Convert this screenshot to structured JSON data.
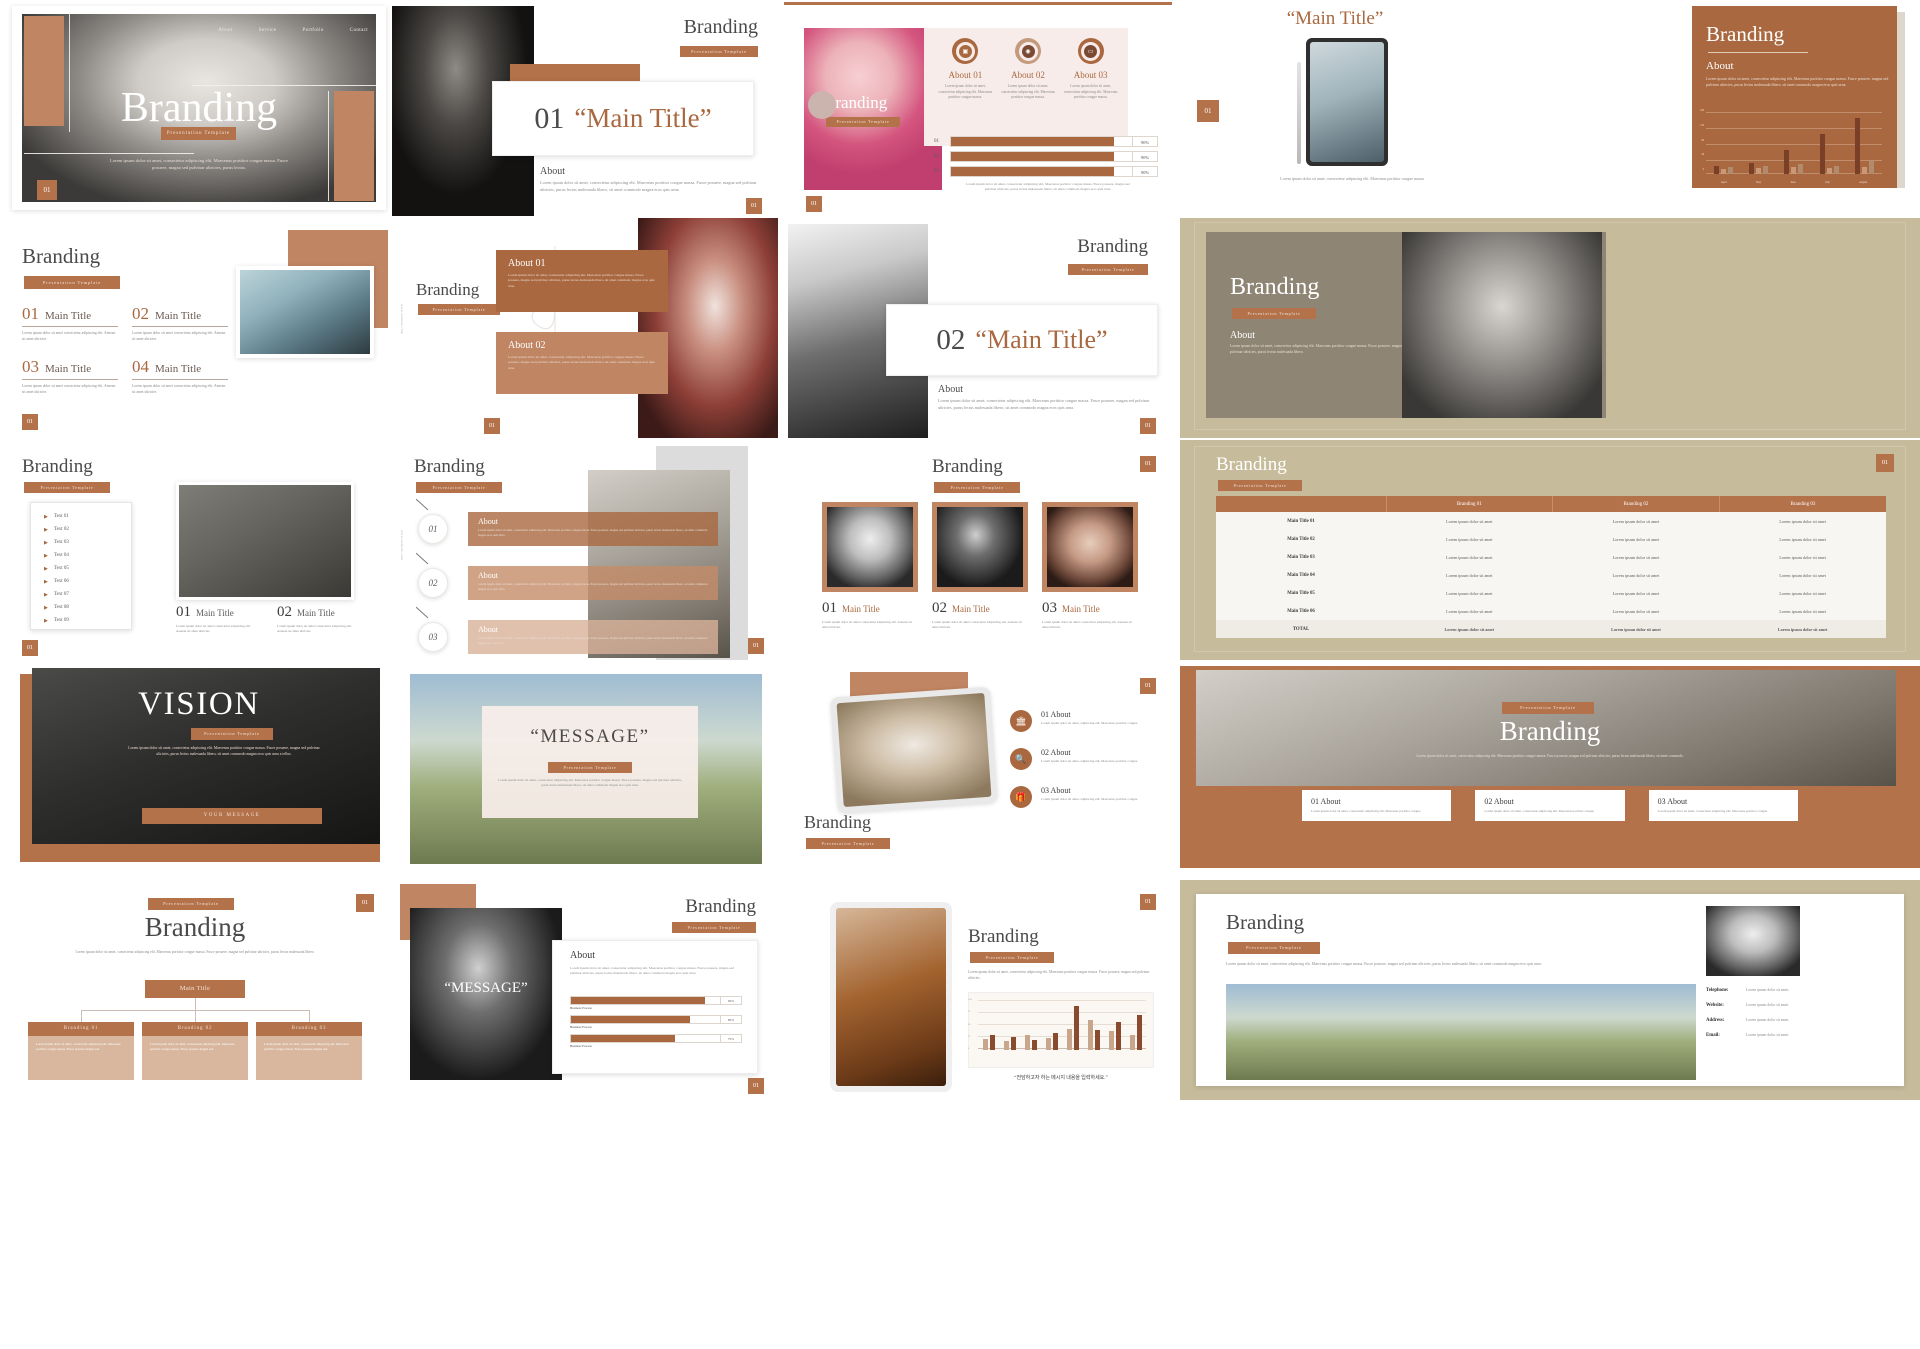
{
  "theme": {
    "accent": "#b3724a",
    "accent_dark": "#a9683f",
    "accent_light": "#c89a7c",
    "beige": "#c6bb9a",
    "taupe": "#8e8574",
    "cream": "#f7efe9",
    "text_dark": "#4a4a4a",
    "text_muted": "#8b8b8b"
  },
  "common": {
    "brand": "Branding",
    "template_badge": "Presentation Template",
    "about": "About",
    "page_num": "01",
    "lorem_short": "Lorem ipsum dolor sit amet, consectetur adipiscing elit. Maecenas porttitor congue massa.",
    "lorem_mid": "Lorem ipsum dolor sit amet, consectetur adipiscing elit. Maecenas porttitor congue massa. Fusce posuere, magna sed pulvinar ultricies, purus lectus malesuada libero, sit amet commodo magna eros quis urna.",
    "lorem_cell": "Lorem ipsum dolor sit amet",
    "lorem_tiny": "Lorem ipsum dolor sit amet consectetur adipiscing elit. Aenean sit amet ultricies"
  },
  "slide01": {
    "title": "Branding",
    "badge": "Presentation Template",
    "nav": [
      "About",
      "Service",
      "Portfolio",
      "Contact"
    ],
    "body": "Lorem ipsum dolor sit amet, consectetur adipiscing elit. Maecenas porttitor congue massa. Fusce posuere, magna sed pulvinar ultricies, purus lectus.",
    "num": "01"
  },
  "slide02": {
    "brand": "Branding",
    "badge": "Presentation Template",
    "number": "01",
    "main_title": "“Main Title”",
    "about": "About",
    "body": "Lorem ipsum dolor sit amet, consectetur adipiscing elit. Maecenas porttitor congue massa. Fusce posuere, magna sed pulvinar ultricies, purus lectus malesuada libero, sit amet commodo magna eros quis urna.",
    "num": "01"
  },
  "slide03": {
    "brand": "Branding",
    "badge": "Presentation Template",
    "cards": [
      {
        "icon": "image-icon",
        "title": "About 01",
        "body": "Lorem ipsum dolor sit amet, consectetur adipiscing elit. Maecenas porttitor congue massa."
      },
      {
        "icon": "camera-icon",
        "title": "About 02",
        "body": "Lorem ipsum dolor sit amet, consectetur adipiscing elit. Maecenas porttitor congue massa."
      },
      {
        "icon": "laptop-icon",
        "title": "About 03",
        "body": "Lorem ipsum dolor sit amet, consectetur adipiscing elit. Maecenas porttitor congue massa."
      }
    ],
    "bars": [
      {
        "label": "01",
        "pct": "90%",
        "value": 90
      },
      {
        "label": "02",
        "pct": "90%",
        "value": 90
      },
      {
        "label": "03",
        "pct": "90%",
        "value": 90
      }
    ],
    "footer": "Lorem ipsum dolor sit amet, consectetur adipiscing elit. Maecenas porttitor congue massa. Fusce posuere, magna sed pulvinar ultricies, purus lectus malesuada libero, sit amet commodo magna eros quis urna.",
    "num": "01"
  },
  "slide04": {
    "main_title": "“Main Title”",
    "number": "01",
    "caption": "Lorem ipsum dolor sit amet, consectetur adipiscing elit. Maecenas porttitor congue massa"
  },
  "slide05": {
    "brand": "Branding",
    "about": "About",
    "body": "Lorem ipsum dolor sit amet, consectetur adipiscing elit. Maecenas porttitor congue massa. Fusce posuere, magna sed pulvinar ultricies, purus lectus malesuada libero, sit amet commodo magna eros quis urna.",
    "chart_data": {
      "type": "bar",
      "title": "",
      "categories": [
        "April",
        "May",
        "June",
        "July",
        "August"
      ],
      "series": [
        {
          "name": "Series 1",
          "values": [
            18,
            25,
            55,
            20,
            14
          ]
        },
        {
          "name": "Series 2",
          "values": [
            10,
            12,
            14,
            92,
            130
          ]
        },
        {
          "name": "Series 3",
          "values": [
            14,
            16,
            22,
            18,
            28
          ]
        }
      ],
      "ylim": [
        0,
        160
      ],
      "yticks": [
        "0",
        "40",
        "80",
        "120",
        "160"
      ],
      "grid": true,
      "legend": "none"
    }
  },
  "slide06": {
    "brand": "Branding",
    "badge": "Presentation Template",
    "items": [
      {
        "num": "01",
        "title": "Main Title",
        "body": "Lorem ipsum dolor sit amet consectetur adipiscing elit. Aenean sit amet ultricies"
      },
      {
        "num": "02",
        "title": "Main Title",
        "body": "Lorem ipsum dolor sit amet consectetur adipiscing elit. Aenean sit amet ultricies"
      },
      {
        "num": "03",
        "title": "Main Title",
        "body": "Lorem ipsum dolor sit amet consectetur adipiscing elit. Aenean sit amet ultricies"
      },
      {
        "num": "04",
        "title": "Main Title",
        "body": "Lorem ipsum dolor sit amet consectetur adipiscing elit. Aenean sit amet ultricies"
      }
    ],
    "num": "01"
  },
  "slide07": {
    "brand": "Branding",
    "badge": "Presentation Template",
    "vertical_label": "www.website.com",
    "blocks": [
      {
        "title": "About 01",
        "body": "Lorem ipsum dolor sit amet, consectetur adipiscing elit. Maecenas porttitor congue massa. Fusce posuere, magna sed pulvinar ultricies, purus lectus malesuada libero, sit amet commodo magna eros quis urna."
      },
      {
        "title": "About 02",
        "body": "Lorem ipsum dolor sit amet, consectetur adipiscing elit. Maecenas porttitor congue massa. Fusce posuere, magna sed pulvinar ultricies, purus lectus malesuada libero, sit amet commodo magna eros quis urna."
      }
    ],
    "num": "01"
  },
  "slide08": {
    "brand": "Branding",
    "badge": "Presentation Template",
    "number": "02",
    "main_title": "“Main Title”",
    "about": "About",
    "body": "Lorem ipsum dolor sit amet, consectetur adipiscing elit. Maecenas porttitor congue massa. Fusce posuere, magna sed pulvinar ultricies, purus lectus malesuada libero, sit amet commodo magna eros quis urna.",
    "num": "01"
  },
  "slide09": {
    "brand": "Branding",
    "badge": "Presentation Template",
    "about": "About",
    "body": "Lorem ipsum dolor sit amet, consectetur adipiscing elit. Maecenas porttitor congue massa. Fusce posuere, magna sed pulvinar ultricies, purus lectus malesuada libero.",
    "num": "01"
  },
  "slide10": {
    "brand": "Branding",
    "badge": "Presentation Template",
    "list": [
      "Text 01",
      "Text 02",
      "Text 03",
      "Text 04",
      "Text 05",
      "Text 06",
      "Text 07",
      "Text 08",
      "Text 09"
    ],
    "num": "01"
  },
  "slide11": {
    "items": [
      {
        "num": "01",
        "title": "Main Title",
        "body": "Lorem ipsum dolor sit amet consectetur adipiscing elit. Aenean sit amet ultricies"
      },
      {
        "num": "02",
        "title": "Main Title",
        "body": "Lorem ipsum dolor sit amet consectetur adipiscing elit. Aenean sit amet ultricies"
      }
    ]
  },
  "slide12": {
    "brand": "Branding",
    "badge": "Presentation Template",
    "vertical_label": "www.website.com",
    "steps": [
      {
        "num": "01",
        "title": "About",
        "body": "Lorem ipsum dolor sit amet, consectetur adipiscing elit. Maecenas porttitor congue massa. Fusce posuere, magna sed pulvinar ultricies, purus lectus malesuada libero, sit amet commodo magna eros quis urna."
      },
      {
        "num": "02",
        "title": "About",
        "body": "Lorem ipsum dolor sit amet, consectetur adipiscing elit. Maecenas porttitor congue massa. Fusce posuere, magna sed pulvinar ultricies, purus lectus malesuada libero, sit amet commodo magna eros quis urna."
      },
      {
        "num": "03",
        "title": "About",
        "body": "Lorem ipsum dolor sit amet, consectetur adipiscing elit. Maecenas porttitor congue massa. Fusce posuere, magna sed pulvinar ultricies, purus lectus malesuada libero, sit amet commodo magna eros quis urna."
      }
    ],
    "num": "01"
  },
  "slide13": {
    "brand": "Branding",
    "badge": "Presentation Template",
    "cards": [
      {
        "num": "01",
        "title": "Main Title",
        "body": "Lorem ipsum dolor sit amet consectetur adipiscing elit. Aenean sit amet ultricies"
      },
      {
        "num": "02",
        "title": "Main Title",
        "body": "Lorem ipsum dolor sit amet consectetur adipiscing elit. Aenean sit amet ultricies"
      },
      {
        "num": "03",
        "title": "Main Title",
        "body": "Lorem ipsum dolor sit amet consectetur adipiscing elit. Aenean sit amet ultricies"
      }
    ],
    "num": "01"
  },
  "slide14": {
    "brand": "Branding",
    "badge": "Presentation Template",
    "num": "01",
    "table": {
      "headers": [
        "",
        "Branding 01",
        "Branding 02",
        "Branding 03"
      ],
      "rows": [
        [
          "Main Title 01",
          "Lorem ipsum dolor sit amet",
          "Lorem ipsum dolor sit amet",
          "Lorem ipsum dolor sit amet"
        ],
        [
          "Main Title 02",
          "Lorem ipsum dolor sit amet",
          "Lorem ipsum dolor sit amet",
          "Lorem ipsum dolor sit amet"
        ],
        [
          "Main Title 03",
          "Lorem ipsum dolor sit amet",
          "Lorem ipsum dolor sit amet",
          "Lorem ipsum dolor sit amet"
        ],
        [
          "Main Title 04",
          "Lorem ipsum dolor sit amet",
          "Lorem ipsum dolor sit amet",
          "Lorem ipsum dolor sit amet"
        ],
        [
          "Main Title 05",
          "Lorem ipsum dolor sit amet",
          "Lorem ipsum dolor sit amet",
          "Lorem ipsum dolor sit amet"
        ],
        [
          "Main Title 06",
          "Lorem ipsum dolor sit amet",
          "Lorem ipsum dolor sit amet",
          "Lorem ipsum dolor sit amet"
        ]
      ],
      "total_row": [
        "TOTAL",
        "Lorem ipsum dolor sit amet",
        "Lorem ipsum dolor sit amet",
        "Lorem ipsum dolor sit amet"
      ]
    }
  },
  "slide15": {
    "title": "VISION",
    "badge": "Presentation Template",
    "body": "Lorem ipsum dolor sit amet, consectetur adipiscing elit. Maecenas porttitor congue massa. Fusce posuere, magna sed pulvinar ultricies, purus lectus malesuada libero, sit amet commodo magna eros quis urna a tellus.",
    "footer": "YOUR    MESSAGE"
  },
  "slide16": {
    "title": "“MESSAGE”",
    "badge": "Presentation Template",
    "body": "Lorem ipsum dolor sit amet, consectetur adipiscing elit. Maecenas porttitor congue massa. Fusce posuere, magna sed pulvinar ultricies, purus lectus malesuada libero, sit amet commodo magna eros quis urna."
  },
  "slide17": {
    "brand": "Branding",
    "badge": "Presentation Template",
    "num": "01",
    "items": [
      {
        "icon": "building-icon",
        "title": "01 About",
        "body": "Lorem ipsum dolor sit amet, adipiscing elit. Maecenas porttitor congue"
      },
      {
        "icon": "search-icon",
        "title": "02 About",
        "body": "Lorem ipsum dolor sit amet, adipiscing elit. Maecenas porttitor congue"
      },
      {
        "icon": "gift-icon",
        "title": "03 About",
        "body": "Lorem ipsum dolor sit amet, adipiscing elit. Maecenas porttitor congue"
      }
    ]
  },
  "slide18": {
    "brand": "Branding",
    "badge": "Presentation Template",
    "body": "Lorem ipsum dolor sit amet, consectetur adipiscing elit. Maecenas porttitor congue massa. Fusce posuere, magna sed pulvinar ultricies, purus lectus malesuada libero, sit amet commodo.",
    "cards": [
      {
        "title": "01 About",
        "body": "Lorem ipsum dolor sit amet, consectetur adipiscing elit. Maecenas porttitor congue"
      },
      {
        "title": "02 About",
        "body": "Lorem ipsum dolor sit amet, consectetur adipiscing elit. Maecenas porttitor congue"
      },
      {
        "title": "03 About",
        "body": "Lorem ipsum dolor sit amet, consectetur adipiscing elit. Maecenas porttitor congue"
      }
    ]
  },
  "slide19": {
    "badge_top": "Presentation Template",
    "brand": "Branding",
    "body": "Lorem ipsum dolor sit amet, consectetur adipiscing elit. Maecenas porttitor congue massa. Fusce posuere, magna sed pulvinar ultricies, purus lectus malesuada libero.",
    "root": "Main Title",
    "nodes": [
      {
        "title": "Branding 01",
        "body": "Lorem ipsum dolor sit amet, consectetur adipiscing elit. Maecenas porttitor congue massa. Fusce posuere magna sed."
      },
      {
        "title": "Branding 02",
        "body": "Lorem ipsum dolor sit amet, consectetur adipiscing elit. Maecenas porttitor congue massa. Fusce posuere magna sed."
      },
      {
        "title": "Branding 03",
        "body": "Lorem ipsum dolor sit amet, consectetur adipiscing elit. Maecenas porttitor congue massa. Fusce posuere magna sed."
      }
    ],
    "num": "01"
  },
  "slide20": {
    "brand": "Branding",
    "badge": "Presentation Template",
    "message": "“MESSAGE”",
    "about": "About",
    "body": "Lorem ipsum dolor sit amet, consectetur adipiscing elit. Maecenas porttitor congue massa. Fusce posuere, magna sed pulvinar ultricies, purus lectus malesuada libero, sit amet commodo magna eros quis urna.",
    "bars": [
      {
        "label": "Business Process",
        "pct": "90%",
        "value": 90
      },
      {
        "label": "Business Process",
        "pct": "80%",
        "value": 80
      },
      {
        "label": "Business Process",
        "pct": "70%",
        "value": 70
      }
    ],
    "num": "01"
  },
  "slide21": {
    "brand": "Branding",
    "badge": "Presentation Template",
    "body": "Lorem ipsum dolor sit amet, consectetur adipiscing elit. Maecenas porttitor congue massa. Fusce posuere, magna sed pulvinar ultricies.",
    "quote": "“전담하고자 하는 메시지 내용을 입력하세요.”",
    "num": "01",
    "chart_data": {
      "type": "bar",
      "categories": [
        "01",
        "02",
        "03",
        "04",
        "05",
        "06",
        "07",
        "08"
      ],
      "series": [
        {
          "name": "Series 1",
          "values": [
            22,
            18,
            30,
            24,
            42,
            60,
            38,
            30
          ]
        },
        {
          "name": "Series 2",
          "values": [
            30,
            26,
            20,
            34,
            88,
            40,
            56,
            70
          ]
        }
      ],
      "ylim": [
        0,
        100
      ],
      "yticks": [
        "0",
        "25",
        "50",
        "75",
        "100"
      ],
      "grid": true,
      "legend": "none"
    }
  },
  "slide22": {
    "brand": "Branding",
    "badge": "Presentation Template",
    "body": "Lorem ipsum dolor sit amet, consectetur adipiscing elit. Maecenas porttitor congue massa. Fusce posuere, magna sed pulvinar ultricies, purus lectus malesuada libero, sit amet commodo magna eros quis urna.",
    "contact": [
      {
        "label": "Telephone:",
        "value": "Lorem ipsum dolor sit amet."
      },
      {
        "label": "Website:",
        "value": "Lorem ipsum dolor sit amet."
      },
      {
        "label": "Address:",
        "value": "Lorem ipsum dolor sit amet."
      },
      {
        "label": "Email:",
        "value": "Lorem ipsum dolor sit amet."
      }
    ]
  }
}
